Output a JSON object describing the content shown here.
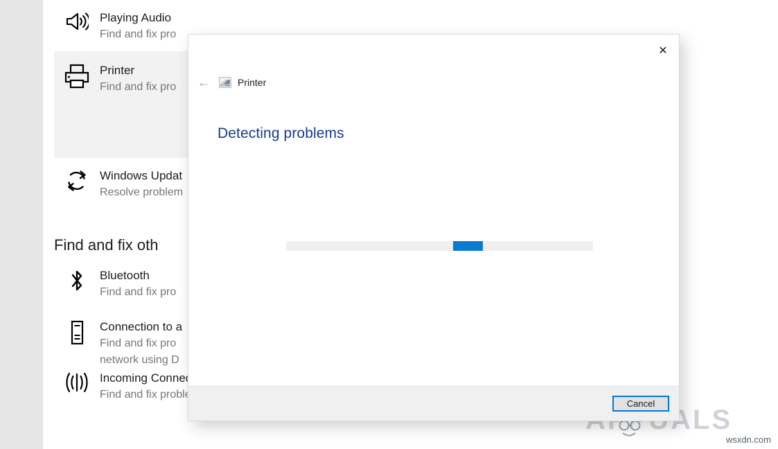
{
  "settings_page": {
    "troubleshooters": [
      {
        "id": "playing-audio",
        "icon": "speaker-icon",
        "title": "Playing Audio",
        "description": "Find and fix pro",
        "selected": false
      },
      {
        "id": "printer",
        "icon": "printer-icon",
        "title": "Printer",
        "description": "Find and fix pro",
        "selected": true
      },
      {
        "id": "windows-update",
        "icon": "refresh-icon",
        "title": "Windows Updat",
        "description": "Resolve problem",
        "selected": false
      }
    ],
    "section_heading": "Find and fix oth",
    "other_troubleshooters": [
      {
        "id": "bluetooth",
        "icon": "bluetooth-icon",
        "title": "Bluetooth",
        "description": "Find and fix pro",
        "selected": false
      },
      {
        "id": "connection-to-a-workplace",
        "icon": "device-icon",
        "title": "Connection to a",
        "description": "Find and fix pro\nnetwork using D",
        "selected": false
      },
      {
        "id": "incoming-connections",
        "icon": "broadcast-icon",
        "title": "Incoming Connections",
        "description": "Find and fix problems with incoming computer connections and",
        "selected": false
      }
    ]
  },
  "dialog": {
    "close_label": "✕",
    "back_label": "←",
    "header_icon": "printer-small-icon",
    "header_title": "Printer",
    "heading": "Detecting problems",
    "progress": {
      "type": "indeterminate",
      "track_color": "#efefef",
      "block_color": "#0b7ad1"
    },
    "cancel_label": "Cancel"
  },
  "watermark": {
    "brand": "APPUALS",
    "site": "wsxdn.com"
  },
  "colors": {
    "accent": "#0078d7",
    "heading_blue": "#153a8a",
    "selected_row": "#f2f2f2",
    "gutter": "#e6e6e6",
    "footer": "#f0f0f0"
  }
}
